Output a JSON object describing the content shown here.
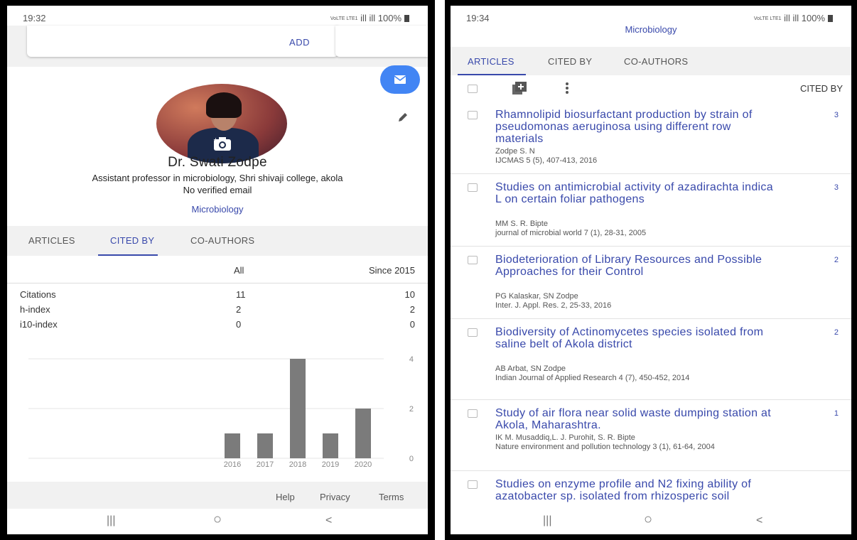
{
  "left": {
    "status": {
      "time": "19:32",
      "signal": "ill ill",
      "battery": "100%",
      "carrier": "VoLTE LTE1"
    },
    "add_label": "ADD",
    "profile": {
      "name": "Dr. Swati Zodpe",
      "affiliation": "Assistant professor in microbiology, Shri shivaji college, akola",
      "email": "No verified email",
      "interest": "Microbiology"
    },
    "tabs": [
      "ARTICLES",
      "CITED BY",
      "CO-AUTHORS"
    ],
    "active_tab": "CITED BY",
    "stats": {
      "col_all": "All",
      "col_since": "Since 2015",
      "rows": [
        {
          "label": "Citations",
          "all": "11",
          "since": "10"
        },
        {
          "label": "h-index",
          "all": "2",
          "since": "2"
        },
        {
          "label": "i10-index",
          "all": "0",
          "since": "0"
        }
      ]
    },
    "footer": {
      "help": "Help",
      "privacy": "Privacy",
      "terms": "Terms"
    },
    "nav": {
      "recent": "|||",
      "home": "○",
      "back": "<"
    }
  },
  "chart_data": {
    "type": "bar",
    "categories": [
      "2016",
      "2017",
      "2018",
      "2019",
      "2020"
    ],
    "values": [
      1,
      1,
      4,
      1,
      2
    ],
    "yticks": [
      "0",
      "2",
      "4"
    ],
    "ylim": [
      0,
      4
    ],
    "bar_color": "#7b7b7b",
    "grid": true
  },
  "right": {
    "status": {
      "time": "19:34",
      "signal": "ill ill",
      "battery": "100%",
      "carrier": "VoLTE LTE1"
    },
    "title": "Microbiology",
    "tabs": [
      "ARTICLES",
      "CITED BY",
      "CO-AUTHORS"
    ],
    "active_tab": "ARTICLES",
    "toolbar": {
      "cited_by_header": "CITED BY",
      "add_icon": "add-to-library-icon",
      "more_icon": "more-vert-icon"
    },
    "articles": [
      {
        "title": "Rhamnolipid biosurfactant production by strain of pseudomonas aeruginosa using different row materials",
        "authors": "Zodpe S. N",
        "venue": "IJCMAS 5 (5), 407-413, 2016",
        "cited": "3"
      },
      {
        "title": "Studies on antimicrobial activity of azadirachta indica L on certain foliar pathogens",
        "authors": "MM S. R. Bipte",
        "venue": "journal of microbial world 7 (1), 28-31, 2005",
        "cited": "3"
      },
      {
        "title": "Biodeterioration of Library Resources and Possible Approaches for their Control",
        "authors": "PG Kalaskar, SN Zodpe",
        "venue": "Inter. J. Appl. Res. 2, 25-33, 2016",
        "cited": "2"
      },
      {
        "title": "Biodiversity of Actinomycetes species isolated from saline belt of Akola district",
        "authors": "AB Arbat, SN Zodpe",
        "venue": "Indian Journal of Applied Research 4 (7), 450-452, 2014",
        "cited": "2"
      },
      {
        "title": "Study of air flora near solid waste dumping station at Akola, Maharashtra.",
        "authors": "IK M. Musaddiq,L. J. Purohit, S. R. Bipte",
        "venue": "Nature environment and pollution technology 3 (1), 61-64, 2004",
        "cited": "1"
      },
      {
        "title": "Studies on enzyme profile and N2 fixing ability of azatobacter sp. isolated from rhizosperic soil",
        "authors": "",
        "venue": "",
        "cited": ""
      }
    ],
    "nav": {
      "recent": "|||",
      "home": "○",
      "back": "<"
    }
  }
}
